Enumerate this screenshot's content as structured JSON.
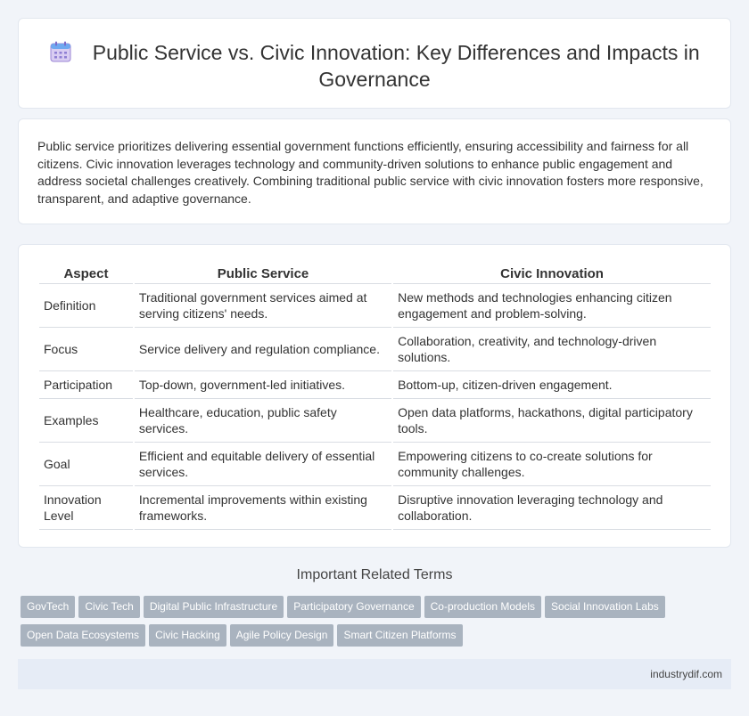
{
  "header": {
    "title": "Public Service vs. Civic Innovation: Key Differences and Impacts in Governance",
    "icon": "calendar-icon"
  },
  "intro": {
    "text": "Public service prioritizes delivering essential government functions efficiently, ensuring accessibility and fairness for all citizens. Civic innovation leverages technology and community-driven solutions to enhance public engagement and address societal challenges creatively. Combining traditional public service with civic innovation fosters more responsive, transparent, and adaptive governance."
  },
  "table": {
    "headers": [
      "Aspect",
      "Public Service",
      "Civic Innovation"
    ],
    "rows": [
      [
        "Definition",
        "Traditional government services aimed at serving citizens' needs.",
        "New methods and technologies enhancing citizen engagement and problem-solving."
      ],
      [
        "Focus",
        "Service delivery and regulation compliance.",
        "Collaboration, creativity, and technology-driven solutions."
      ],
      [
        "Participation",
        "Top-down, government-led initiatives.",
        "Bottom-up, citizen-driven engagement."
      ],
      [
        "Examples",
        "Healthcare, education, public safety services.",
        "Open data platforms, hackathons, digital participatory tools."
      ],
      [
        "Goal",
        "Efficient and equitable delivery of essential services.",
        "Empowering citizens to co-create solutions for community challenges."
      ],
      [
        "Innovation Level",
        "Incremental improvements within existing frameworks.",
        "Disruptive innovation leveraging technology and collaboration."
      ]
    ]
  },
  "related": {
    "title": "Important Related Terms",
    "tags": [
      "GovTech",
      "Civic Tech",
      "Digital Public Infrastructure",
      "Participatory Governance",
      "Co-production Models",
      "Social Innovation Labs",
      "Open Data Ecosystems",
      "Civic Hacking",
      "Agile Policy Design",
      "Smart Citizen Platforms"
    ]
  },
  "footer": {
    "site": "industrydif.com"
  },
  "colors": {
    "background": "#f1f4f9",
    "tag": "#a9b3bf",
    "footer": "#e6ecf6"
  }
}
